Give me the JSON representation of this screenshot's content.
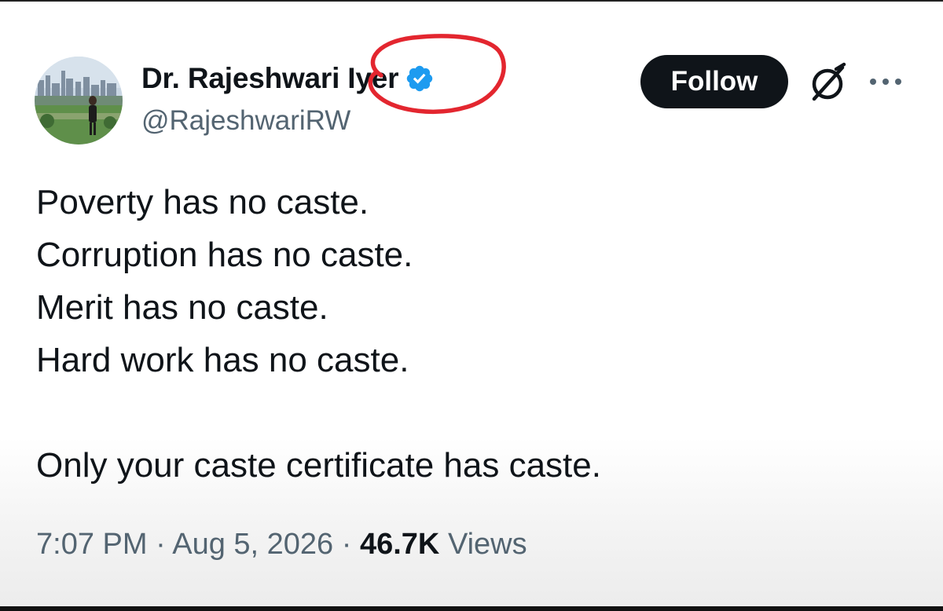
{
  "author": {
    "display_name": "Dr. Rajeshwari Iyer",
    "handle": "@RajeshwariRW",
    "verified": true,
    "verified_color": "#1d9bf0"
  },
  "actions": {
    "follow_label": "Follow",
    "grok_icon": "grok-icon",
    "more_icon": "more-options-icon"
  },
  "annotation": {
    "circle_color": "#e3262f"
  },
  "tweet": {
    "lines": [
      "Poverty has no caste.",
      "Corruption has no caste.",
      "Merit has no caste.",
      "Hard work has no caste."
    ],
    "closing_line": "Only your caste certificate has caste."
  },
  "meta": {
    "time": "7:07 PM",
    "separator": "·",
    "date": "Aug 5, 2026",
    "views_count": "46.7K",
    "views_label": "Views"
  }
}
